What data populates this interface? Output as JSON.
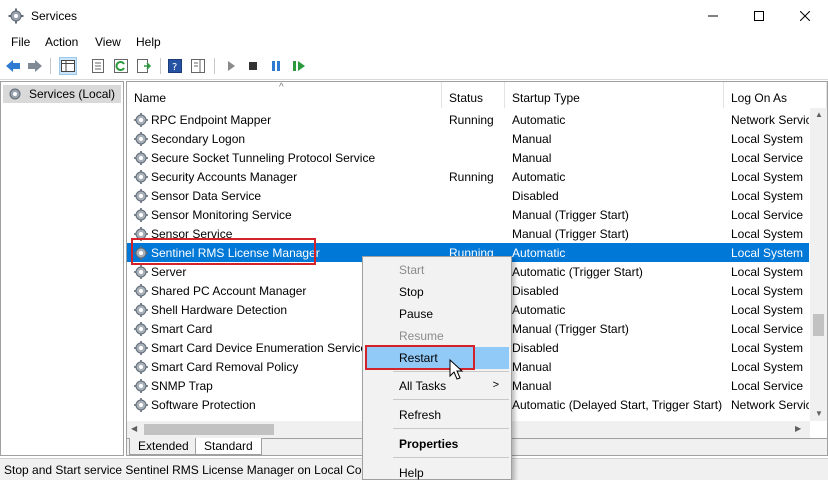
{
  "window": {
    "title": "Services"
  },
  "menu": [
    "File",
    "Action",
    "View",
    "Help"
  ],
  "tree": {
    "root_label": "Services (Local)"
  },
  "columns": {
    "name": "Name",
    "status": "Status",
    "startup": "Startup Type",
    "logon": "Log On As"
  },
  "services": [
    {
      "name": "RPC Endpoint Mapper",
      "status": "Running",
      "startup": "Automatic",
      "logon": "Network Service"
    },
    {
      "name": "Secondary Logon",
      "status": "",
      "startup": "Manual",
      "logon": "Local System"
    },
    {
      "name": "Secure Socket Tunneling Protocol Service",
      "status": "",
      "startup": "Manual",
      "logon": "Local Service"
    },
    {
      "name": "Security Accounts Manager",
      "status": "Running",
      "startup": "Automatic",
      "logon": "Local System"
    },
    {
      "name": "Sensor Data Service",
      "status": "",
      "startup": "Disabled",
      "logon": "Local System"
    },
    {
      "name": "Sensor Monitoring Service",
      "status": "",
      "startup": "Manual (Trigger Start)",
      "logon": "Local Service"
    },
    {
      "name": "Sensor Service",
      "status": "",
      "startup": "Manual (Trigger Start)",
      "logon": "Local System"
    },
    {
      "name": "Sentinel RMS License Manager",
      "status": "Running",
      "startup": "Automatic",
      "logon": "Local System"
    },
    {
      "name": "Server",
      "status": "",
      "startup": "Automatic (Trigger Start)",
      "logon": "Local System"
    },
    {
      "name": "Shared PC Account Manager",
      "status": "",
      "startup": "Disabled",
      "logon": "Local System"
    },
    {
      "name": "Shell Hardware Detection",
      "status": "",
      "startup": "Automatic",
      "logon": "Local System"
    },
    {
      "name": "Smart Card",
      "status": "",
      "startup": "Manual (Trigger Start)",
      "logon": "Local Service"
    },
    {
      "name": "Smart Card Device Enumeration Service",
      "status": "",
      "startup": "Disabled",
      "logon": "Local System"
    },
    {
      "name": "Smart Card Removal Policy",
      "status": "",
      "startup": "Manual",
      "logon": "Local System"
    },
    {
      "name": "SNMP Trap",
      "status": "",
      "startup": "Manual",
      "logon": "Local Service"
    },
    {
      "name": "Software Protection",
      "status": "",
      "startup": "Automatic (Delayed Start, Trigger Start)",
      "logon": "Network Service"
    }
  ],
  "selected_index": 7,
  "tabs": [
    "Extended",
    "Standard"
  ],
  "active_tab": "Standard",
  "status_text": "Stop and Start service Sentinel RMS License Manager on Local Computer",
  "context_menu": {
    "start": "Start",
    "stop": "Stop",
    "pause": "Pause",
    "resume": "Resume",
    "restart": "Restart",
    "all_tasks": "All Tasks",
    "refresh": "Refresh",
    "properties": "Properties",
    "help": "Help"
  },
  "colors": {
    "selection": "#0078d7",
    "highlight": "#d3222a",
    "menu_hover": "#91c9f7"
  }
}
